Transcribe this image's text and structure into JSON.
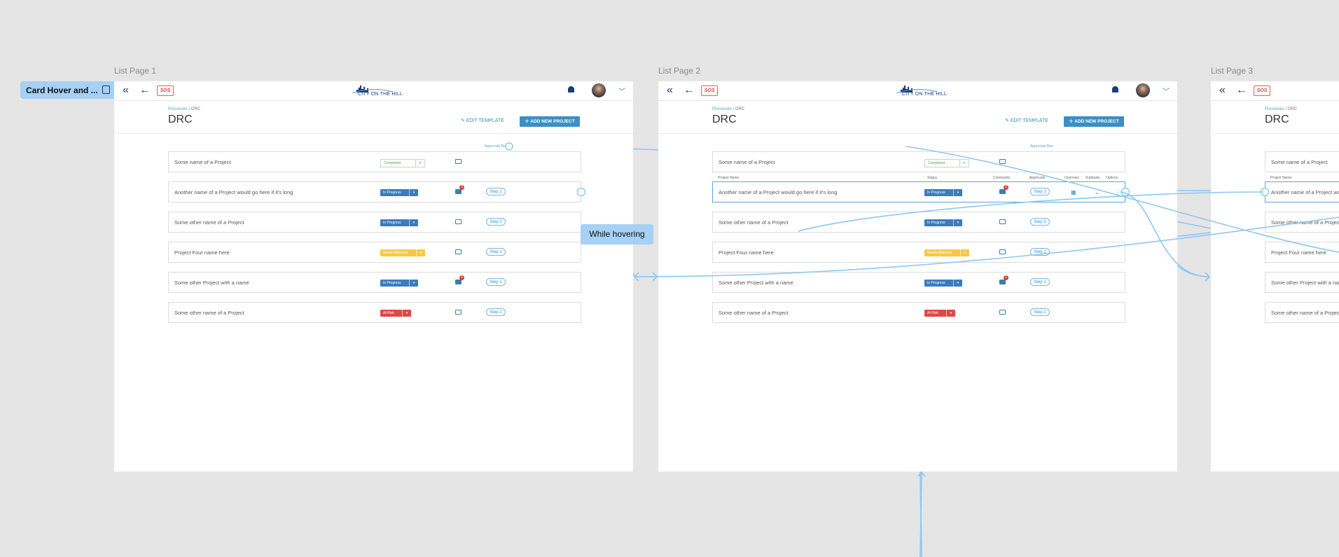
{
  "flow": {
    "start_label": "Card Hover and ..."
  },
  "tooltip": "While hovering",
  "frames": [
    {
      "title": "List Page 1"
    },
    {
      "title": "List Page 2"
    },
    {
      "title": "List Page 3"
    }
  ],
  "app": {
    "logo_text": "CITY ON THE HILL",
    "sos": "SOS",
    "breadcrumb_root": "Processes",
    "breadcrumb_sep": "/",
    "breadcrumb_current": "DRC",
    "page_title": "DRC",
    "edit_template": "EDIT TEMPLATE",
    "add_new_project": "ADD NEW PROJECT",
    "approvals_label": "Approvals Re",
    "approvals_label_full": "Approvals Ree"
  },
  "columns": {
    "project_name": "Project Name",
    "status": "Status",
    "comments": "Comments",
    "approvals": "Approvals",
    "overview": "Overview",
    "subtasks": "Subtasks",
    "options": "Options"
  },
  "rows": [
    {
      "name": "Some name of a Project",
      "status": "Completed",
      "status_color": "#ffffff",
      "status_text_color": "#4caf50",
      "comment_badge": "",
      "step": ""
    },
    {
      "name": "Another name of a Project would go here if it's long",
      "status": "In Progress",
      "status_color": "#3b7bbf",
      "status_text_color": "#ffffff",
      "comment_badge": "3",
      "step": "Step 2"
    },
    {
      "name": "Some other name of a Project",
      "status": "In Progress",
      "status_color": "#3b7bbf",
      "status_text_color": "#ffffff",
      "comment_badge": "",
      "step": "Step 2"
    },
    {
      "name": "Project Four name here",
      "status": "Needs Attention",
      "status_color": "#f5c945",
      "status_text_color": "#ffffff",
      "comment_badge": "",
      "step": "Step 1"
    },
    {
      "name": "Some other Project with a name",
      "status": "In Progress",
      "status_color": "#3b7bbf",
      "status_text_color": "#ffffff",
      "comment_badge": "1",
      "step": "Step 1"
    },
    {
      "name": "Some other name of a Project",
      "status": "At Risk",
      "status_color": "#e04848",
      "status_text_color": "#ffffff",
      "comment_badge": "",
      "step": "Step 2"
    }
  ],
  "colors": {
    "primary": "#3b8fc4",
    "navy": "#1f3b7a",
    "connector": "#8cc8f0",
    "background": "#e5e5e5"
  }
}
